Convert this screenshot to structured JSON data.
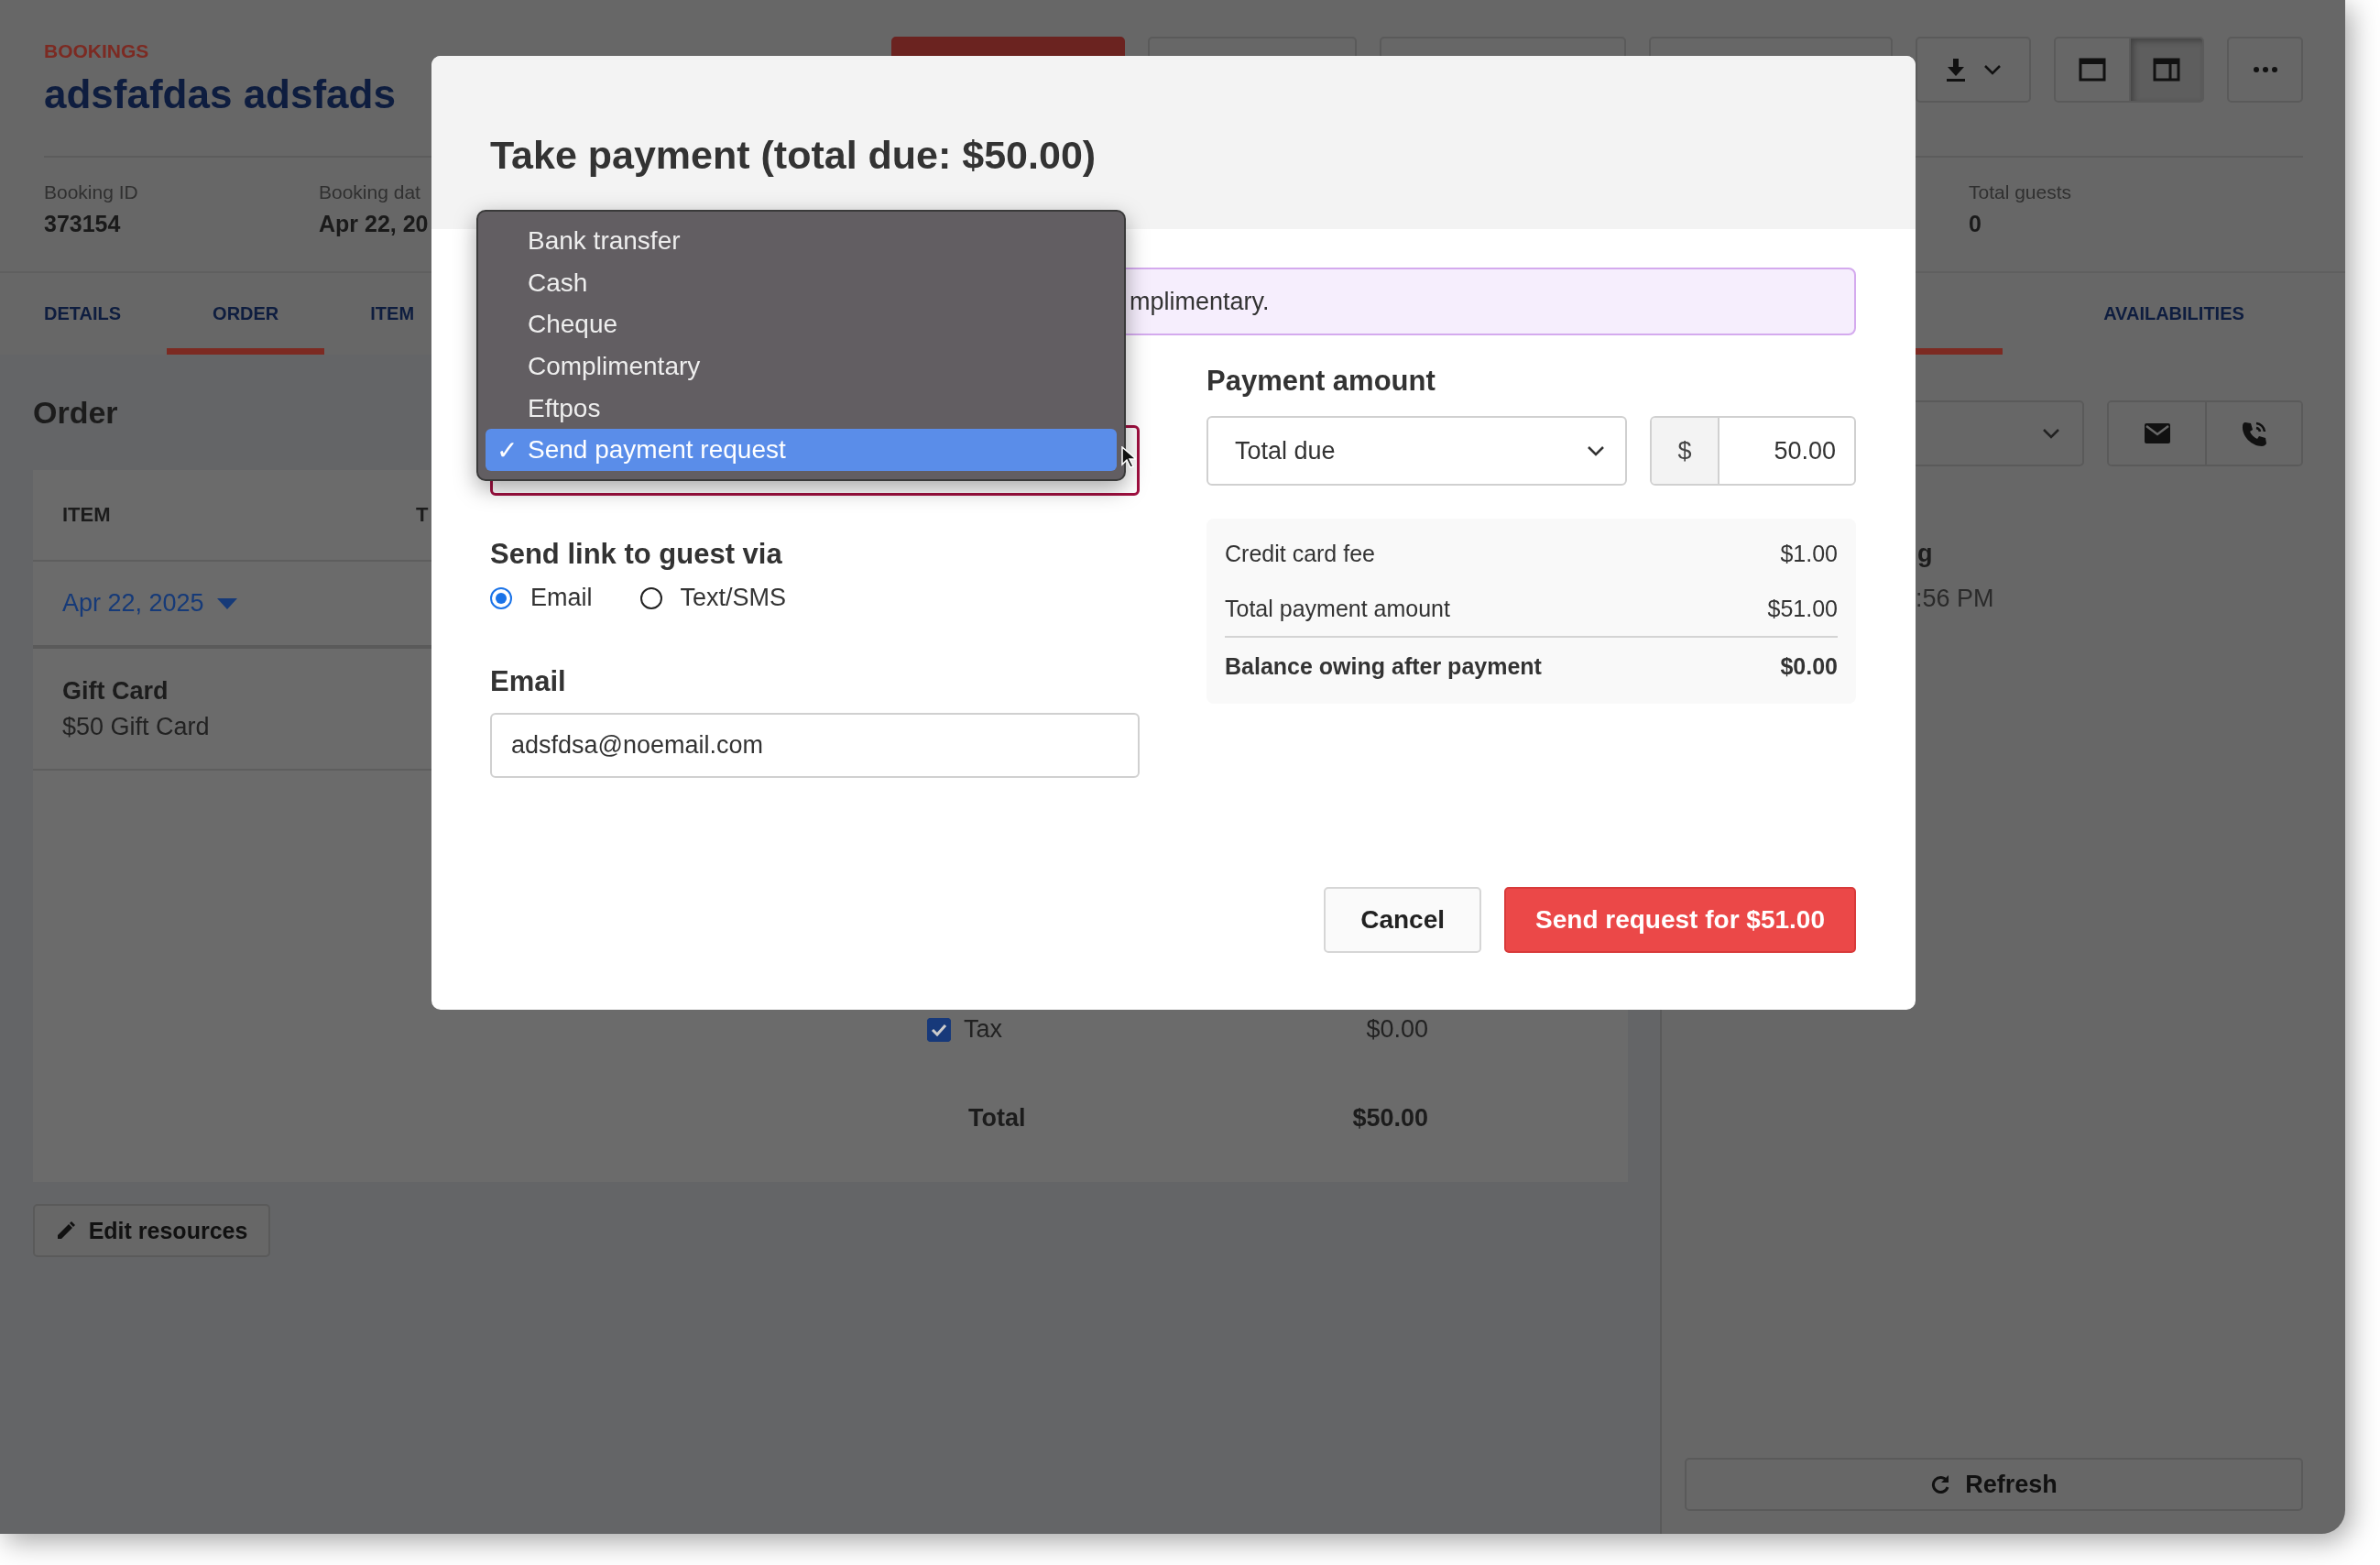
{
  "page": {
    "breadcrumb": "BOOKINGS",
    "title": "adsfafdas adsfads",
    "view_toggle": [
      {
        "selected": false
      },
      {
        "selected": true
      }
    ],
    "info": [
      {
        "label": "Booking ID",
        "value": "373154"
      },
      {
        "label": "Booking dat",
        "value": "Apr 22, 20"
      },
      {
        "label": "Total guests",
        "value": "0"
      }
    ],
    "tabs": [
      {
        "label": "DETAILS",
        "selected": false
      },
      {
        "label": "ORDER",
        "selected": true
      },
      {
        "label": "ITEM",
        "selected": false
      }
    ],
    "side_tabs": [
      {
        "selected": true
      },
      {
        "label": "AVAILABILITIES",
        "selected": false
      }
    ],
    "order": {
      "heading": "Order",
      "columns": [
        "ITEM",
        "T"
      ],
      "date": "Apr 22, 2025",
      "item": {
        "name": "Gift Card",
        "description": "$50 Gift Card"
      },
      "tax": {
        "label": "Tax",
        "checked": true,
        "amount": "$0.00"
      },
      "total": {
        "label": "Total",
        "amount": "$50.00"
      }
    },
    "edit_button": "Edit resources",
    "side": {
      "entry_title": "g",
      "entry_time": ":56 PM",
      "refresh": "Refresh"
    }
  },
  "modal": {
    "title": "Take payment (total due: $50.00)",
    "check_mark": "✓",
    "method_options": [
      {
        "label": "Bank transfer",
        "selected": false
      },
      {
        "label": "Cash",
        "selected": false
      },
      {
        "label": "Cheque",
        "selected": false
      },
      {
        "label": "Complimentary",
        "selected": false
      },
      {
        "label": "Eftpos",
        "selected": false
      },
      {
        "label": "Send payment request",
        "selected": true
      }
    ],
    "notice": "mplimentary.",
    "send_via": {
      "label": "Send link to guest via",
      "options": [
        {
          "label": "Email",
          "selected": true
        },
        {
          "label": "Text/SMS",
          "selected": false
        }
      ]
    },
    "email": {
      "label": "Email",
      "value": "adsfdsa@noemail.com"
    },
    "amount": {
      "label": "Payment amount",
      "mode": "Total due",
      "currency": "$",
      "value": "50.00"
    },
    "summary": [
      {
        "label": "Credit card fee",
        "value": "$1.00",
        "kind": "normal"
      },
      {
        "label": "Total payment amount",
        "value": "$51.00",
        "kind": "normal"
      },
      {
        "label": "Balance owing after payment",
        "value": "$0.00",
        "kind": "total"
      }
    ],
    "buttons": [
      {
        "label": "Cancel",
        "kind": "secondary"
      },
      {
        "label": "Send request for $51.00",
        "kind": "primary"
      }
    ]
  }
}
